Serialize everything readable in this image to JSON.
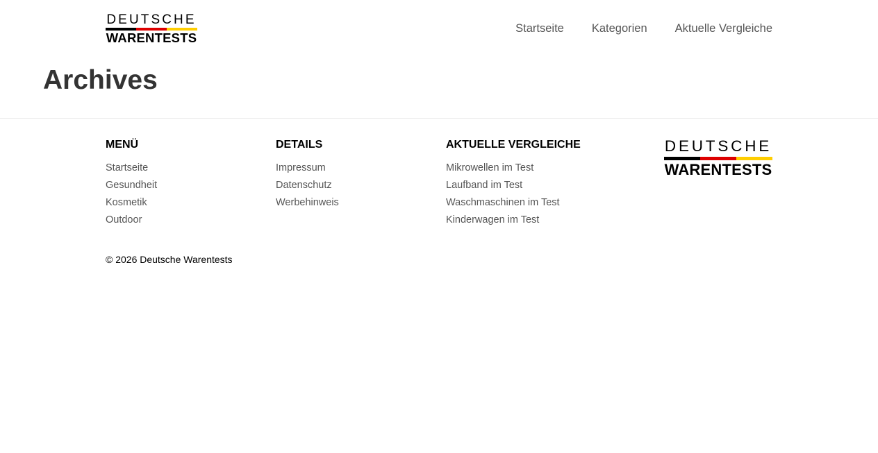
{
  "brand": {
    "logo_top": "DEUTSCHE",
    "logo_bottom": "WARENTESTS",
    "flag_colors": [
      "#000000",
      "#dd0000",
      "#ffce00"
    ]
  },
  "nav": {
    "items": [
      {
        "label": "Startseite"
      },
      {
        "label": "Kategorien"
      },
      {
        "label": "Aktuelle Vergleiche"
      }
    ]
  },
  "page": {
    "title": "Archives"
  },
  "footer": {
    "menu": {
      "heading": "MENÜ",
      "items": [
        "Startseite",
        "Gesundheit",
        "Kosmetik",
        "Outdoor"
      ]
    },
    "details": {
      "heading": "DETAILS",
      "items": [
        "Impressum",
        "Datenschutz",
        "Werbehinweis"
      ]
    },
    "compare": {
      "heading": "AKTUELLE VERGLEICHE",
      "items": [
        "Mikrowellen im Test",
        "Laufband im Test",
        "Waschmaschinen im Test",
        "Kinderwagen im Test"
      ]
    },
    "copyright": "© 2026 Deutsche Warentests"
  }
}
